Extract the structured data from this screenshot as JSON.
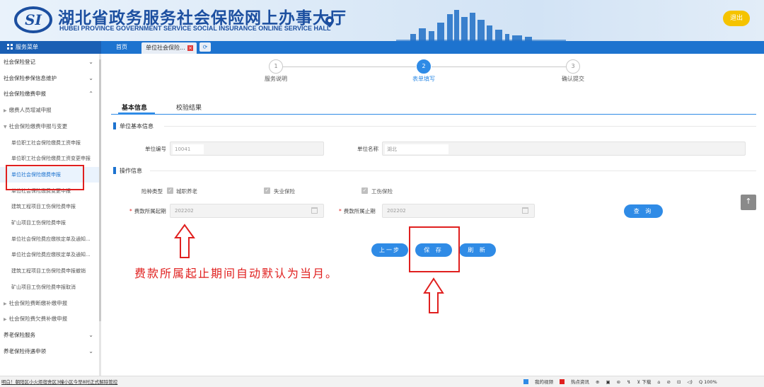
{
  "header": {
    "title": "湖北省政务服务社会保险网上办事大厅",
    "subtitle": "HUBEI PROVINCE GOVERNMENT SERVICE SOCIAL INSURANCE ONLINE SERVICE HALL",
    "logout_label": "退出",
    "brand_color": "#1c4fa0"
  },
  "menu_title": "服务菜单",
  "tabs": {
    "home": "首页",
    "active": "单位社会保险...",
    "close_symbol": "×"
  },
  "sidebar": [
    {
      "label": "社会保险登记",
      "level": 0,
      "chevron": "⌄"
    },
    {
      "label": "社会保险参保信息维护",
      "level": 0,
      "chevron": "⌄"
    },
    {
      "label": "社会保险缴费申报",
      "level": 0,
      "chevron": "⌃"
    },
    {
      "label": "缴费人员增减申报",
      "level": 1,
      "chevron": ""
    },
    {
      "label": "社会保险缴费申报与变更",
      "level": 1,
      "chevron": ""
    },
    {
      "label": "单位职工社会保险缴费工资申报",
      "level": 2,
      "chevron": ""
    },
    {
      "label": "单位职工社会保险缴费工资变更申报",
      "level": 2,
      "chevron": ""
    },
    {
      "label": "单位社会保险缴费申报",
      "level": 2,
      "chevron": ""
    },
    {
      "label": "单位社会保险缴费变更申报",
      "level": 2,
      "chevron": ""
    },
    {
      "label": "建筑工程项目工伤保险费申报",
      "level": 2,
      "chevron": ""
    },
    {
      "label": "矿山项目工伤保险费申报",
      "level": 2,
      "chevron": ""
    },
    {
      "label": "单位社会保险费应缴核定单及通知...",
      "level": 2,
      "chevron": ""
    },
    {
      "label": "单位社会保险费应缴核定单及通知...",
      "level": 2,
      "chevron": ""
    },
    {
      "label": "建筑工程项目工伤保险费申报撤销",
      "level": 2,
      "chevron": ""
    },
    {
      "label": "矿山项目工伤保险费申报取消",
      "level": 2,
      "chevron": ""
    },
    {
      "label": "社会保险费断缴补缴申报",
      "level": 1,
      "chevron": ""
    },
    {
      "label": "社会保险费欠费补缴申报",
      "level": 1,
      "chevron": ""
    },
    {
      "label": "养老保险服务",
      "level": 0,
      "chevron": "⌄"
    },
    {
      "label": "养老保险待遇申领",
      "level": 0,
      "chevron": "⌄"
    }
  ],
  "steps": [
    {
      "num": "1",
      "label": "服务说明"
    },
    {
      "num": "2",
      "label": "表单填写"
    },
    {
      "num": "3",
      "label": "确认提交"
    }
  ],
  "form_tabs": {
    "basic": "基本信息",
    "check": "校验结果"
  },
  "section_unit": "单位基本信息",
  "section_op": "操作信息",
  "fields": {
    "unit_no_label": "单位编号",
    "unit_no_value": "10041",
    "unit_name_label": "单位名称",
    "unit_name_value": "湖北",
    "insurance_type_label": "险种类型",
    "ins1": "城职养老",
    "ins2": "失业保险",
    "ins3": "工伤保险",
    "period_start_label": "费款所属起期",
    "period_start_value": "202202",
    "period_end_label": "费款所属止期",
    "period_end_value": "202202",
    "required_mark": "*"
  },
  "buttons": {
    "query": "查 询",
    "prev": "上一步",
    "save": "保 存",
    "refresh": "刷 新",
    "top": "↑"
  },
  "annotation": "费款所属起止期间自动默认为当月。",
  "status_bar": {
    "left": "明白！朝阳区小火炬宿舍区3幢小区今早8时正式解除管控",
    "items": [
      "我的视频",
      "热点资讯",
      "⊕",
      "▣",
      "⊜",
      "↯",
      "⊻ 下载",
      "⌂",
      "⊘",
      "⊡",
      "◁)",
      "Q 100%"
    ]
  },
  "colors": {
    "accent": "#2f8be6",
    "highlight": "#e0201f",
    "logout": "#f5c300"
  }
}
